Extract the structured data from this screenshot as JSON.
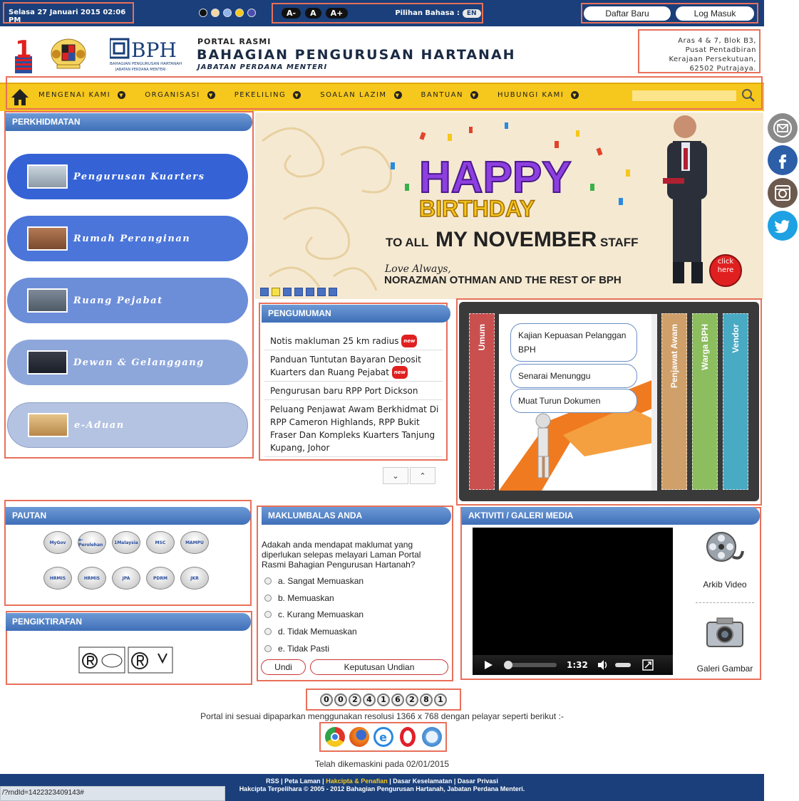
{
  "topbar": {
    "datetime": "Selasa 27 Januari 2015 02:06 PM",
    "theme_colors": [
      "#111111",
      "#f2d8a0",
      "#8fb3e8",
      "#f6c71c",
      "#4b4eae"
    ],
    "font_buttons": [
      "A-",
      "A",
      "A+"
    ],
    "language_label": "Pilihan Bahasa :",
    "language_value": "EN",
    "register_label": "Daftar Baru",
    "login_label": "Log Masuk"
  },
  "header": {
    "logo_one": "1",
    "bph_logo": "BPH",
    "bph_logo_sub1": "BAHAGIAN PENGURUSAN HARTANAH",
    "bph_logo_sub2": "JABATAN PERDANA MENTERI",
    "portal_label": "PORTAL RASMI",
    "portal_title": "BAHAGIAN PENGURUSAN HARTANAH",
    "portal_subtitle": "JABATAN PERDANA MENTERI",
    "address": [
      "Aras 4 & 7, Blok B3,",
      "Pusat Pentadbiran",
      "Kerajaan Persekutuan,",
      "62502 Putrajaya."
    ]
  },
  "nav": {
    "items": [
      "MENGENAI KAMI",
      "ORGANISASI",
      "PEKELILING",
      "SOALAN LAZIM",
      "BANTUAN",
      "HUBUNGI KAMI"
    ],
    "search_placeholder": ""
  },
  "social": [
    "email-icon",
    "facebook-icon",
    "instagram-icon",
    "twitter-icon"
  ],
  "services": {
    "title": "PERKHIDMATAN",
    "items": [
      "Pengurusan Kuarters",
      "Rumah Peranginan",
      "Ruang Pejabat",
      "Dewan & Gelanggang",
      "e-Aduan"
    ]
  },
  "banner": {
    "happy": "HAPPY",
    "birthday": "BIRTHDAY",
    "to_all": "TO ALL",
    "month": "MY NOVEMBER",
    "staff": "STAFF",
    "love": "Love Always,",
    "from": "NORAZMAN OTHMAN AND THE REST OF BPH",
    "click": "click",
    "here": "here"
  },
  "announcements": {
    "title": "PENGUMUMAN",
    "new_badge": "new",
    "items": [
      "Notis makluman 25 km radius",
      "Panduan Tuntutan Bayaran Deposit Kuarters dan Ruang Pejabat",
      "Pengurusan baru RPP Port Dickson",
      "Peluang Penjawat Awam Berkhidmat Di RPP Cameron Highlands, RPP Bukit Fraser Dan Kompleks Kuarters Tanjung Kupang, Johor"
    ]
  },
  "tabs": {
    "labels": [
      "Umum",
      "Penjawat Awam",
      "Warga BPH",
      "Vendor"
    ],
    "buttons": [
      "Kajian Kepuasan Pelanggan BPH",
      "Senarai Menunggu",
      "Muat Turun Dokumen"
    ]
  },
  "links": {
    "title": "PAUTAN",
    "badges": [
      "MyGov",
      "e-Perolehan",
      "1Malaysia",
      "MSC",
      "MAMPU",
      "HRMIS",
      "HRMIS",
      "JPA",
      "PDRM",
      "JKR"
    ]
  },
  "recognition": {
    "title": "PENGIKTIRAFAN"
  },
  "feedback": {
    "title": "MAKLUMBALAS ANDA",
    "question": "Adakah anda mendapat maklumat yang diperlukan selepas melayari Laman Portal Rasmi Bahagian Pengurusan Hartanah?",
    "options": [
      "a. Sangat Memuaskan",
      "b. Memuaskan",
      "c. Kurang Memuaskan",
      "d. Tidak Memuaskan",
      "e. Tidak Pasti"
    ],
    "vote_label": "Undi",
    "results_label": "Keputusan Undian"
  },
  "media": {
    "title": "AKTIVITI / GALERI MEDIA",
    "video_time": "1:32",
    "archive_label": "Arkib Video",
    "gallery_label": "Galeri Gambar"
  },
  "counter": {
    "digits": [
      "0",
      "0",
      "2",
      "4",
      "1",
      "6",
      "2",
      "8",
      "1"
    ]
  },
  "resolution_note": "Portal ini sesuai dipaparkan menggunakan resolusi 1366 x 768 dengan pelayar seperti berikut :-",
  "browsers": [
    "chrome-icon",
    "firefox-icon",
    "ie-icon",
    "opera-icon",
    "safari-icon"
  ],
  "updated": "Telah dikemaskini pada 02/01/2015",
  "footer": {
    "links": [
      "RSS",
      "Peta Laman",
      "Hakcipta & Penafian",
      "Dasar Keselamatan",
      "Dasar Privasi"
    ],
    "copyright": "Hakcipta Terpelihara © 2005 - 2012 Bahagian Pengurusan Hartanah, Jabatan Perdana Menteri."
  },
  "statusbar": {
    "url": "/?rndId=1422323409143#"
  }
}
